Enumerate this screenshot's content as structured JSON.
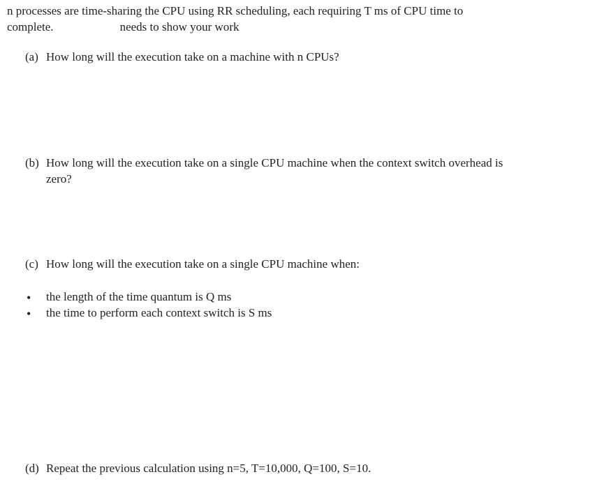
{
  "intro": {
    "line1": "n processes are time-sharing the CPU using RR scheduling, each requiring T ms of CPU time to",
    "line2a": "complete.",
    "line2b": "needs to show your work"
  },
  "parts": {
    "a": {
      "label": "(a)",
      "text": "How long will the execution take on a machine with n CPUs?"
    },
    "b": {
      "label": "(b)",
      "text": "How long will the execution take on a single CPU machine when the context switch overhead is",
      "text2": "zero?"
    },
    "c": {
      "label": "(c)",
      "text": "How long will the execution take on a single CPU machine when:",
      "bullets": [
        "the length of the time quantum is Q ms",
        "the time to perform each context switch is S ms"
      ]
    },
    "d": {
      "label": "(d)",
      "text": "Repeat the previous calculation using n=5, T=10,000, Q=100, S=10."
    }
  }
}
